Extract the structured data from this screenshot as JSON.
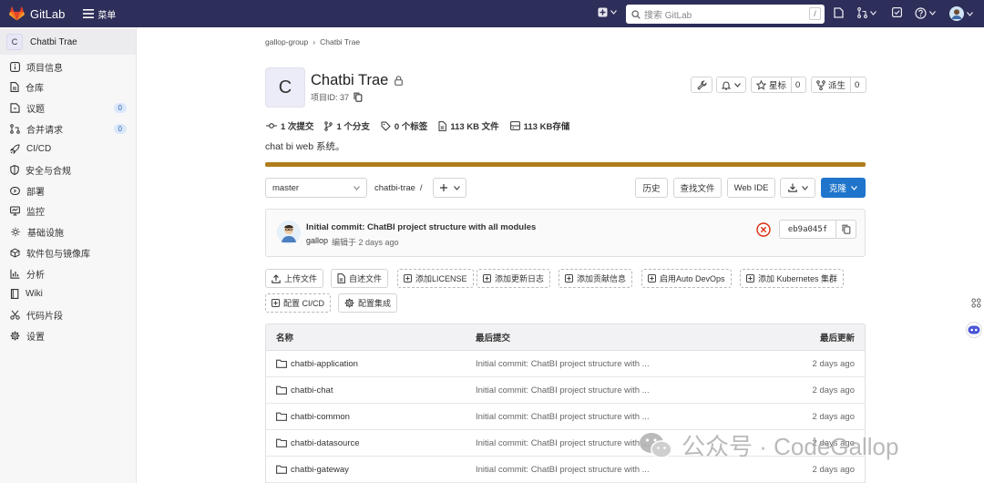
{
  "topbar": {
    "brand": "GitLab",
    "menu_label": "菜单",
    "search_placeholder": "搜索 GitLab",
    "search_shortcut": "/"
  },
  "sidebar": {
    "project_initial": "C",
    "project_name": "Chatbi Trae",
    "items": [
      {
        "label": "项目信息",
        "icon": "info-icon"
      },
      {
        "label": "仓库",
        "icon": "repo-icon"
      },
      {
        "label": "议题",
        "icon": "issues-icon",
        "badge": "0"
      },
      {
        "label": "合并请求",
        "icon": "merge-request-icon",
        "badge": "0"
      },
      {
        "label": "CI/CD",
        "icon": "rocket-icon"
      },
      {
        "label": "安全与合规",
        "icon": "shield-icon"
      },
      {
        "label": "部署",
        "icon": "deploy-icon"
      },
      {
        "label": "监控",
        "icon": "monitor-icon"
      },
      {
        "label": "基础设施",
        "icon": "cloud-icon"
      },
      {
        "label": "软件包与镜像库",
        "icon": "package-icon"
      },
      {
        "label": "分析",
        "icon": "chart-icon"
      },
      {
        "label": "Wiki",
        "icon": "book-icon"
      },
      {
        "label": "代码片段",
        "icon": "scissors-icon"
      },
      {
        "label": "设置",
        "icon": "gear-icon"
      }
    ]
  },
  "breadcrumb": {
    "group": "gallop-group",
    "separator": "›",
    "project": "Chatbi Trae"
  },
  "project": {
    "initial": "C",
    "title": "Chatbi Trae",
    "id_label": "项目ID: 37",
    "star_label": "星标",
    "star_count": "0",
    "fork_label": "派生",
    "fork_count": "0",
    "description": "chat bi web 系统。"
  },
  "stats": {
    "commits": "1 次提交",
    "branches": "1 个分支",
    "tags": "0 个标签",
    "files": "113 KB 文件",
    "storage": "113 KB存储"
  },
  "controls": {
    "branch": "master",
    "path": "chatbi-trae",
    "path_sep": "/",
    "history": "历史",
    "find_file": "查找文件",
    "web_ide": "Web IDE",
    "clone": "克隆"
  },
  "commit": {
    "message": "Initial commit: ChatBI project structure with all modules",
    "author": "gallop",
    "meta": "编辑于 2 days ago",
    "sha": "eb9a045f",
    "status": "failed"
  },
  "quick_actions": [
    {
      "label": "上传文件",
      "icon": "upload-icon",
      "style": "solid"
    },
    {
      "label": "自述文件",
      "icon": "file-icon",
      "style": "solid"
    },
    {
      "label": "添加LICENSE",
      "icon": "plus-square-icon",
      "style": "dashed"
    },
    {
      "label": "添加更新日志",
      "icon": "plus-square-icon",
      "style": "dashed"
    },
    {
      "label": "添加贡献信息",
      "icon": "plus-square-icon",
      "style": "dashed"
    },
    {
      "label": "启用Auto DevOps",
      "icon": "plus-square-icon",
      "style": "dashed"
    },
    {
      "label": "添加 Kubernetes 集群",
      "icon": "plus-square-icon",
      "style": "dashed"
    },
    {
      "label": "配置 CI/CD",
      "icon": "plus-square-icon",
      "style": "dashed"
    },
    {
      "label": "配置集成",
      "icon": "gear-icon",
      "style": "solid"
    }
  ],
  "table": {
    "headers": {
      "name": "名称",
      "last_commit": "最后提交",
      "last_update": "最后更新"
    },
    "rows": [
      {
        "name": "chatbi-application",
        "commit": "Initial commit: ChatBI project structure with ...",
        "updated": "2 days ago"
      },
      {
        "name": "chatbi-chat",
        "commit": "Initial commit: ChatBI project structure with ...",
        "updated": "2 days ago"
      },
      {
        "name": "chatbi-common",
        "commit": "Initial commit: ChatBI project structure with ...",
        "updated": "2 days ago"
      },
      {
        "name": "chatbi-datasource",
        "commit": "Initial commit: ChatBI project structure with ...",
        "updated": "2 days ago"
      },
      {
        "name": "chatbi-gateway",
        "commit": "Initial commit: ChatBI project structure with ...",
        "updated": "2 days ago"
      }
    ]
  },
  "watermark": "公众号 · CodeGallop",
  "colors": {
    "topbar": "#2e2e5a",
    "accent": "#1f75cb",
    "language_bar": "#b07d1c",
    "failed": "#dd2b0e"
  }
}
